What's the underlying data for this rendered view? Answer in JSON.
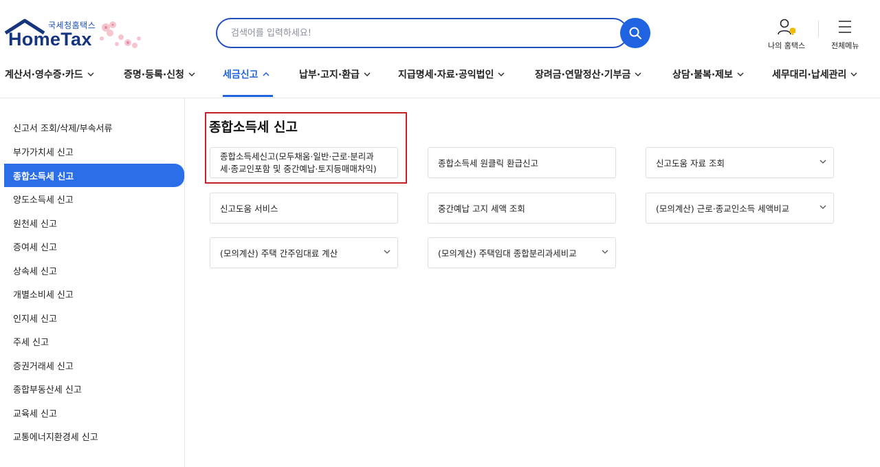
{
  "brand": {
    "logo_sub": "국세청홈택스",
    "logo_main": "HomeTax"
  },
  "search": {
    "placeholder": "검색어를 입력하세요!",
    "icon": "search-icon"
  },
  "utility": {
    "my_hometax": "나의 홈택스",
    "all_menu": "전체메뉴"
  },
  "gnb": [
    {
      "label": "계산서·영수증·카드"
    },
    {
      "label": "증명·등록·신청"
    },
    {
      "label": "세금신고"
    },
    {
      "label": "납부·고지·환급"
    },
    {
      "label": "지급명세·자료·공익법인"
    },
    {
      "label": "장려금·연말정산·기부금"
    },
    {
      "label": "상담·불복·제보"
    },
    {
      "label": "세무대리·납세관리"
    }
  ],
  "sidebar": {
    "items": [
      {
        "label": "신고서 조회/삭제/부속서류"
      },
      {
        "label": "부가가치세 신고"
      },
      {
        "label": "종합소득세 신고"
      },
      {
        "label": "양도소득세 신고"
      },
      {
        "label": "원천세 신고"
      },
      {
        "label": "증여세 신고"
      },
      {
        "label": "상속세 신고"
      },
      {
        "label": "개별소비세 신고"
      },
      {
        "label": "인지세 신고"
      },
      {
        "label": "주세 신고"
      },
      {
        "label": "증권거래세 신고"
      },
      {
        "label": "종합부동산세 신고"
      },
      {
        "label": "교육세 신고"
      },
      {
        "label": "교통에너지환경세 신고"
      }
    ]
  },
  "main": {
    "title": "종합소득세 신고",
    "cards": [
      {
        "line1": "종합소득세신고(모두채움·일반·근로·분리과",
        "line2": "세·종교인포함 및 중간예납·토지등매매차익)"
      },
      {
        "label": "종합소득세 원클릭 환급신고"
      },
      {
        "label": "신고도움 자료 조회"
      },
      {
        "label": "신고도움 서비스"
      },
      {
        "label": "중간예납 고지 세액 조회"
      },
      {
        "label": "(모의계산) 근로·종교인소득 세액비교"
      },
      {
        "label": "(모의계산) 주택 간주임대료 계산"
      },
      {
        "label": "(모의계산) 주택임대 종합분리과세비교"
      }
    ]
  },
  "colors": {
    "primary": "#1f63e0",
    "brand_navy": "#16357f",
    "highlight_border": "#c8202a",
    "sidebar_active": "#2a6ee8"
  }
}
